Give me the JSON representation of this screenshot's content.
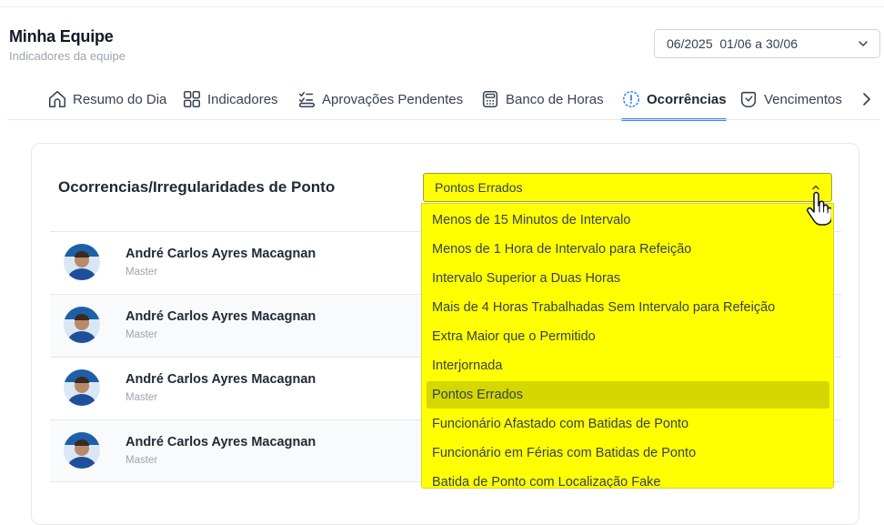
{
  "header": {
    "title": "Minha Equipe",
    "subtitle": "Indicadores da equipe",
    "period": "06/2025  01/06 a 30/06"
  },
  "tabs": [
    {
      "label": "Resumo do Dia",
      "icon": "home-icon"
    },
    {
      "label": "Indicadores",
      "icon": "grid-icon"
    },
    {
      "label": "Aprovações Pendentes",
      "icon": "checklist-icon"
    },
    {
      "label": "Banco de Horas",
      "icon": "calculator-icon"
    },
    {
      "label": "Ocorrências",
      "icon": "alert-circle-icon",
      "active": true
    },
    {
      "label": "Vencimentos",
      "icon": "clock-badge-icon"
    }
  ],
  "card": {
    "title": "Ocorrencias/Irregularidades de Ponto",
    "filter": {
      "selected": "Pontos Errados",
      "options": [
        "Menos de 15 Minutos de Intervalo",
        "Menos de 1 Hora de Intervalo para Refeição",
        "Intervalo Superior a Duas Horas",
        "Mais de 4 Horas Trabalhadas Sem Intervalo para Refeição",
        "Extra Maior que o Permitido",
        "Interjornada",
        "Pontos Errados",
        "Funcionário Afastado com Batidas de Ponto",
        "Funcionário em Férias com Batidas de Ponto",
        "Batida de Ponto com Localização Fake"
      ]
    },
    "rows": [
      {
        "name": "André Carlos Ayres Macagnan",
        "role": "Master"
      },
      {
        "name": "André Carlos Ayres Macagnan",
        "role": "Master"
      },
      {
        "name": "André Carlos Ayres Macagnan",
        "role": "Master"
      },
      {
        "name": "André Carlos Ayres Macagnan",
        "role": "Master"
      }
    ]
  },
  "colors": {
    "accent": "#3b82f6",
    "highlight": "#ffff00",
    "selected_option": "#d4d800"
  }
}
